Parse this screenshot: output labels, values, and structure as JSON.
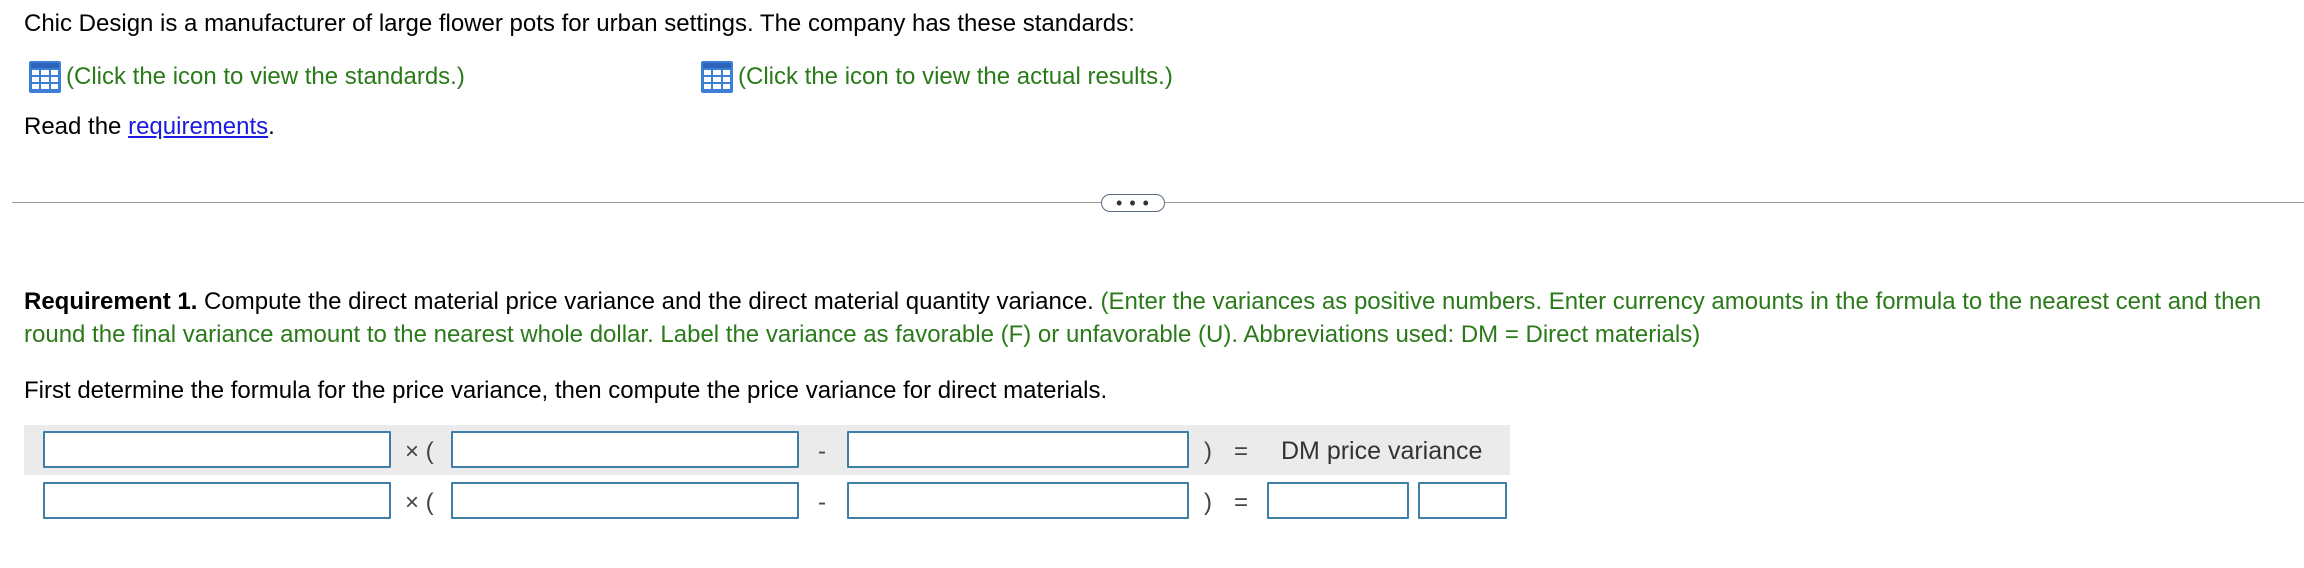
{
  "intro": {
    "text": "Chic Design is a manufacturer of large flower pots for urban settings. The company has these standards:"
  },
  "links": {
    "standards": "(Click the icon to view the standards.)",
    "actual": "(Click the icon to view the actual results.)",
    "icon": "table-grid-icon"
  },
  "read": {
    "prefix": "Read the ",
    "link": "requirements",
    "suffix": "."
  },
  "expander": {
    "label": "• • •"
  },
  "requirement": {
    "bold": "Requirement 1.",
    "text": " Compute the direct material price variance and the direct material quantity variance.",
    "instructions": " (Enter the variances as positive numbers. Enter currency amounts in the formula to the nearest cent and then round the final variance amount to the nearest whole dollar. Label the variance as favorable (F) or unfavorable (U). Abbreviations used: DM = Direct materials)"
  },
  "first_determine": "First determine the formula for the price variance, then compute the price variance for direct materials.",
  "formula": {
    "times": "× (",
    "minus": "-",
    "close": ")",
    "equals": "=",
    "result_label": "DM price variance"
  },
  "colors": {
    "green": "#2a7a1a",
    "link_blue": "#1a1ae0",
    "input_border": "#3f7fa7",
    "icon_blue": "#3d7fd6"
  }
}
